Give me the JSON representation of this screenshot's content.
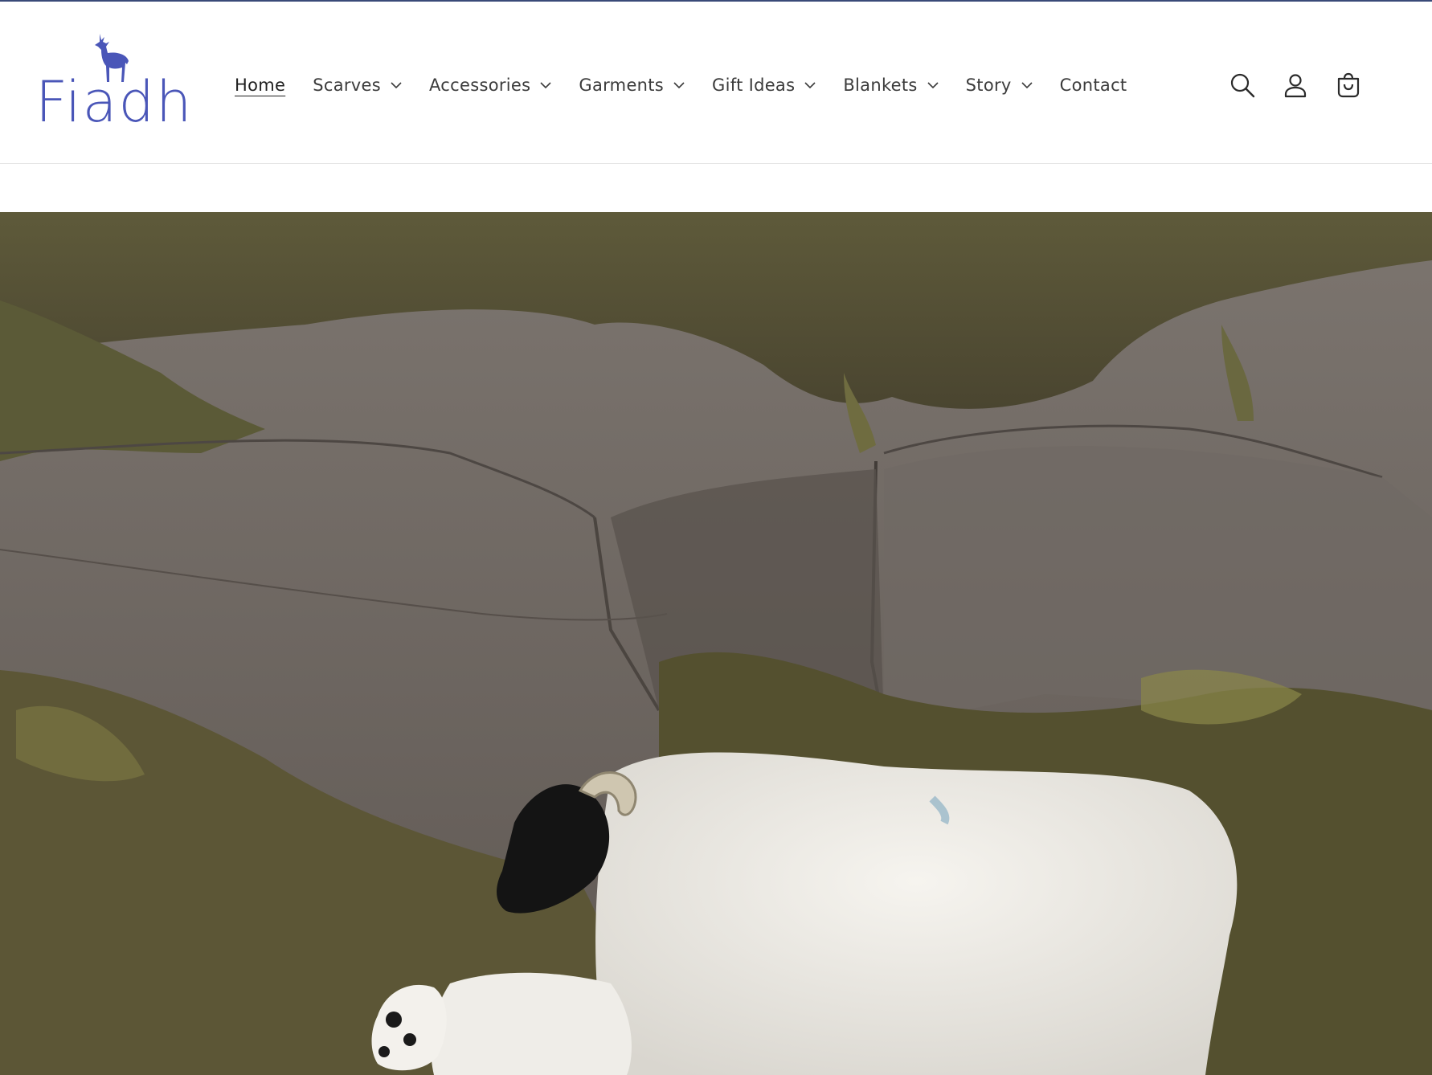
{
  "brand": {
    "logo_text": "Fiadh",
    "logo_icon": "deer-icon",
    "color": "#4a56b8"
  },
  "nav": {
    "items": [
      {
        "label": "Home",
        "active": true,
        "has_dropdown": false
      },
      {
        "label": "Scarves",
        "active": false,
        "has_dropdown": true
      },
      {
        "label": "Accessories",
        "active": false,
        "has_dropdown": true
      },
      {
        "label": "Garments",
        "active": false,
        "has_dropdown": true
      },
      {
        "label": "Gift Ideas",
        "active": false,
        "has_dropdown": true
      },
      {
        "label": "Blankets",
        "active": false,
        "has_dropdown": true
      },
      {
        "label": "Story",
        "active": false,
        "has_dropdown": true
      },
      {
        "label": "Contact",
        "active": false,
        "has_dropdown": false
      }
    ]
  },
  "header_icons": [
    "search-icon",
    "account-icon",
    "cart-icon"
  ],
  "hero": {
    "image": "sheep-on-rocky-hillside"
  },
  "colors": {
    "nav_text": "#3b3b3b",
    "top_border": "#3a4a78"
  }
}
